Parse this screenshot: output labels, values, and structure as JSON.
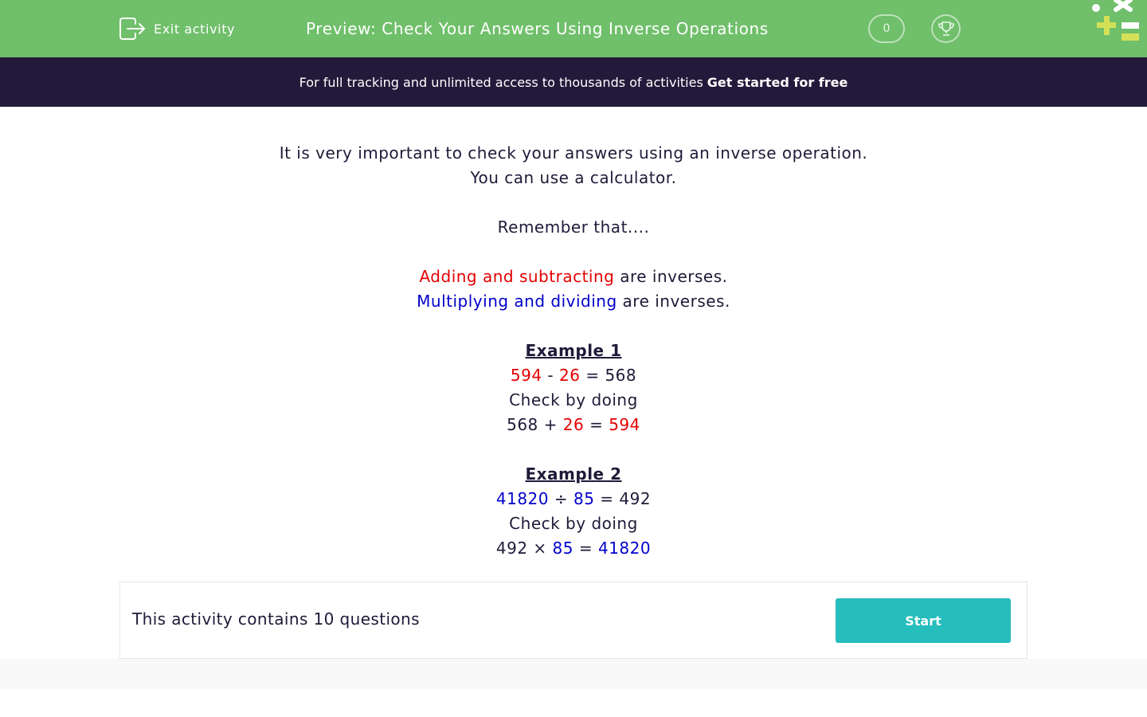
{
  "header": {
    "exit_label": "Exit activity",
    "title": "Preview: Check Your Answers Using Inverse Operations",
    "score": "0",
    "background": "#70bf6b"
  },
  "banner": {
    "text": "For full tracking and unlimited access to thousands of activities",
    "cta": "Get started for free"
  },
  "content": {
    "intro_1": "It is very important to check your answers using an inverse operation.",
    "intro_2": "You can use a calculator.",
    "remember": "Remember that....",
    "add_sub": "Adding and subtracting",
    "mul_div": "Multiplying and dividing",
    "are_inverses": "are inverses.",
    "example1": {
      "heading": "Example 1",
      "a": "594",
      "op1": "-",
      "b": "26",
      "eq": "=",
      "result": "568",
      "check": "Check by doing",
      "c": "568",
      "op2": "+",
      "d": "26",
      "eq2": "=",
      "e": "594"
    },
    "example2": {
      "heading": "Example 2",
      "a": "41820",
      "op1": "÷",
      "b": "85",
      "eq": "=",
      "result": "492",
      "check": "Check by doing",
      "c": "492",
      "op2": "×",
      "d": "85",
      "eq2": "=",
      "e": "41820"
    }
  },
  "footer": {
    "count_text": "This activity contains 10 questions",
    "start_label": "Start"
  },
  "colors": {
    "red": "#e50000",
    "blue": "#0000cc",
    "teal": "#26bdbd",
    "navy": "#231a3b"
  },
  "icons": [
    "exit-icon",
    "trophy-icon",
    "logo-icon"
  ]
}
